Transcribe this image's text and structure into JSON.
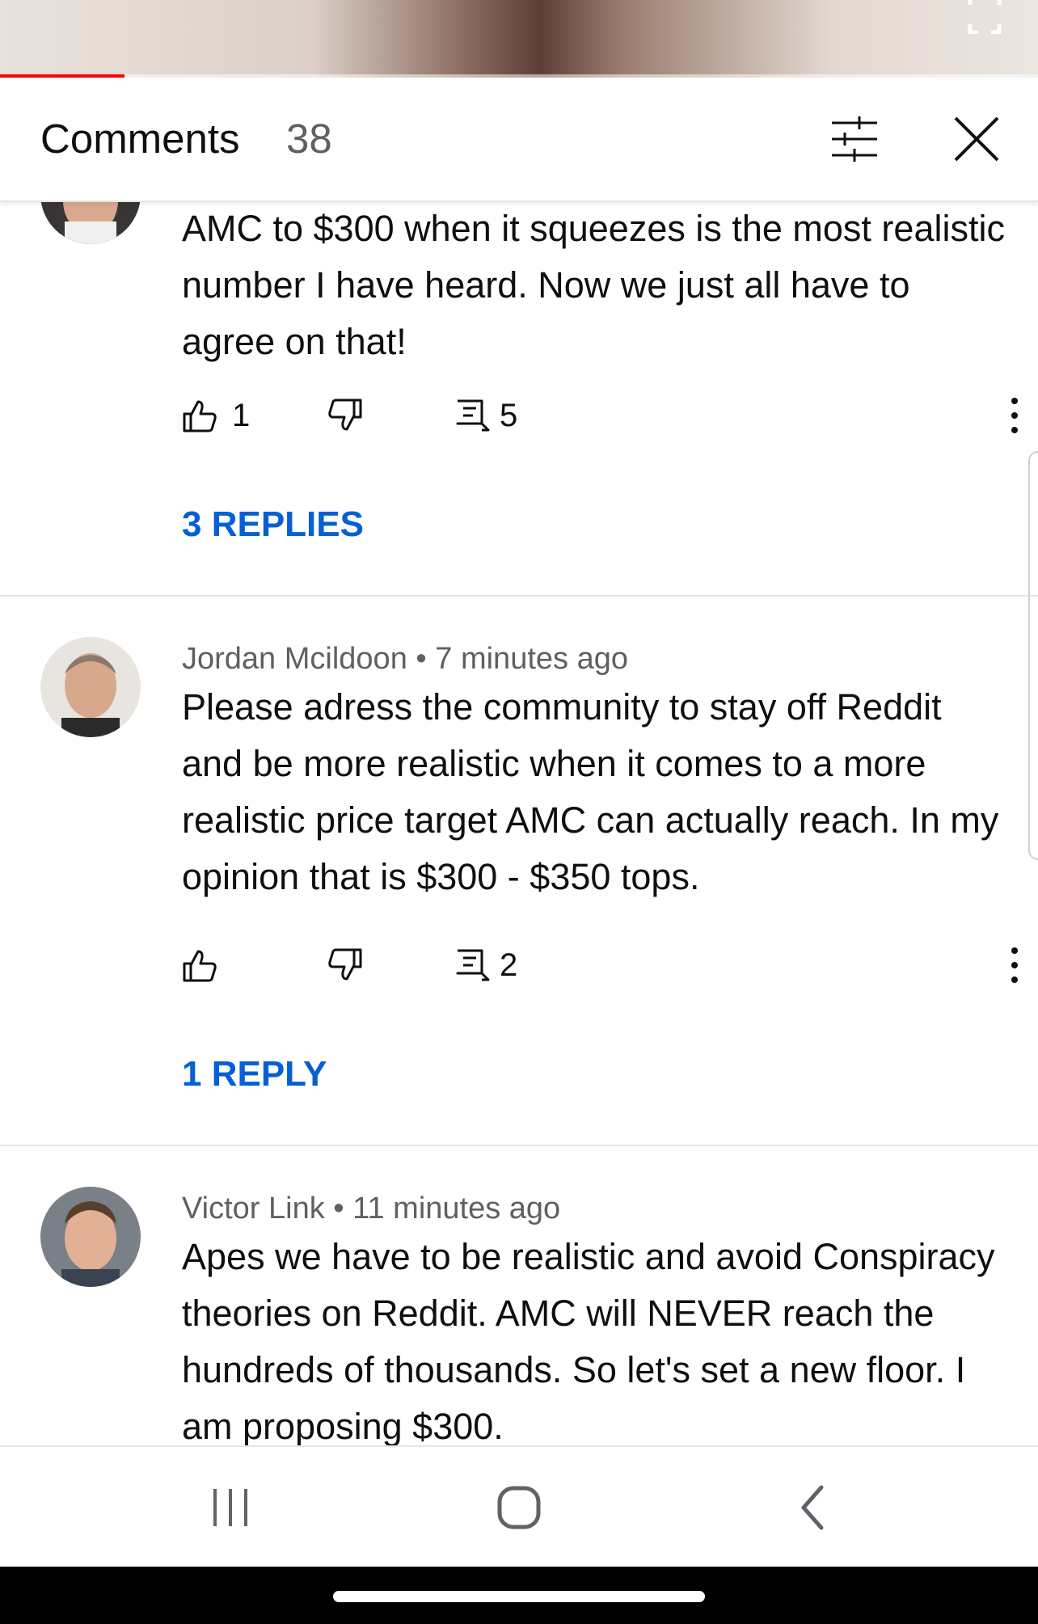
{
  "player": {
    "progress_fraction": 0.12,
    "accent_color": "#ff0000"
  },
  "header": {
    "title": "Comments",
    "count": "38",
    "icons": [
      "sort-icon",
      "close-icon"
    ]
  },
  "comments": [
    {
      "text": "AMC to $300 when it squeezes is the most realistic number I have heard. Now we just all have to agree on that!",
      "likes": "1",
      "replies_count": "5",
      "replies_link": "3 REPLIES"
    },
    {
      "author": "Jordan Mcildoon",
      "separator": "•",
      "time": "7 minutes ago",
      "text": "Please adress the community to stay off Reddit and be more realistic when it comes to a more realistic price target AMC can actually reach. In my opinion that is $300 - $350 tops.",
      "likes": "",
      "replies_count": "2",
      "replies_link": "1 REPLY"
    },
    {
      "author": "Victor Link",
      "separator": "•",
      "time": "11 minutes ago",
      "text": "Apes we have to be realistic and avoid Conspiracy theories on Reddit. AMC will NEVER reach the hundreds of thousands. So let's set a new floor. I am proposing $300."
    }
  ],
  "link_color": "#065fd4",
  "navbar": {
    "icons": [
      "recent-apps-icon",
      "home-icon",
      "back-icon"
    ]
  }
}
